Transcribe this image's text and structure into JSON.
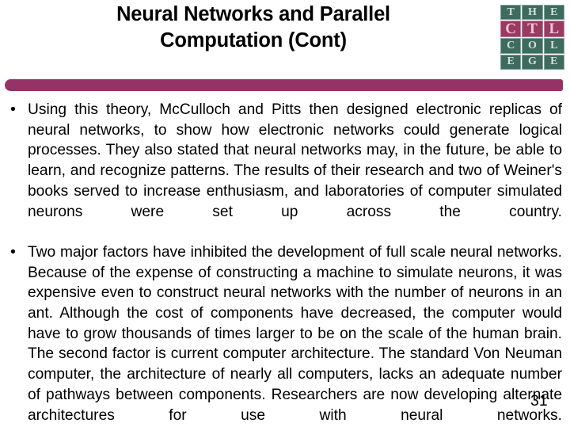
{
  "slide": {
    "title_lines": [
      "Neural Networks and Parallel",
      "Computation (Cont)"
    ],
    "bullet_marker": "•",
    "bullets": [
      "Using this theory, McCulloch and Pitts then designed electronic replicas of neural networks, to show how electronic networks could generate logical processes. They also stated that neural networks may, in the future, be able to learn, and recognize patterns. The results of their research and two of Weiner's books served to increase enthusiasm, and laboratories of computer simulated neurons were set up across the country.",
      "Two major factors have inhibited the development of full scale neural networks. Because of the expense of constructing a machine to simulate neurons, it was expensive even to construct neural networks with the number of neurons in an ant. Although the cost of components have decreased, the computer would have to grow thousands of times larger to be on the scale of the human brain. The second factor is current computer architecture. The standard Von Neuman computer, the architecture of nearly all computers, lacks an adequate number of pathways between components. Researchers are now developing alternate architectures for use with neural networks."
    ],
    "page_number": "31",
    "colors": {
      "divider_bar": "#963365",
      "logo_green": "#3f6b5f",
      "logo_green_text": "#cfe0da",
      "logo_maroon": "#993a60",
      "logo_maroon_text": "#f2c3d4",
      "text": "#000000",
      "background": "#ffffff"
    }
  },
  "logo": {
    "name": "the-ctl-college-logo",
    "rows": [
      {
        "style": "green",
        "cells": [
          "T",
          "H",
          "E"
        ]
      },
      {
        "style": "maroon",
        "cells": [
          "C",
          "T",
          "L"
        ]
      },
      {
        "style": "green",
        "cells": [
          "C",
          "O",
          "L"
        ]
      },
      {
        "style": "green",
        "cells": [
          "E",
          "G",
          "E"
        ]
      }
    ]
  }
}
